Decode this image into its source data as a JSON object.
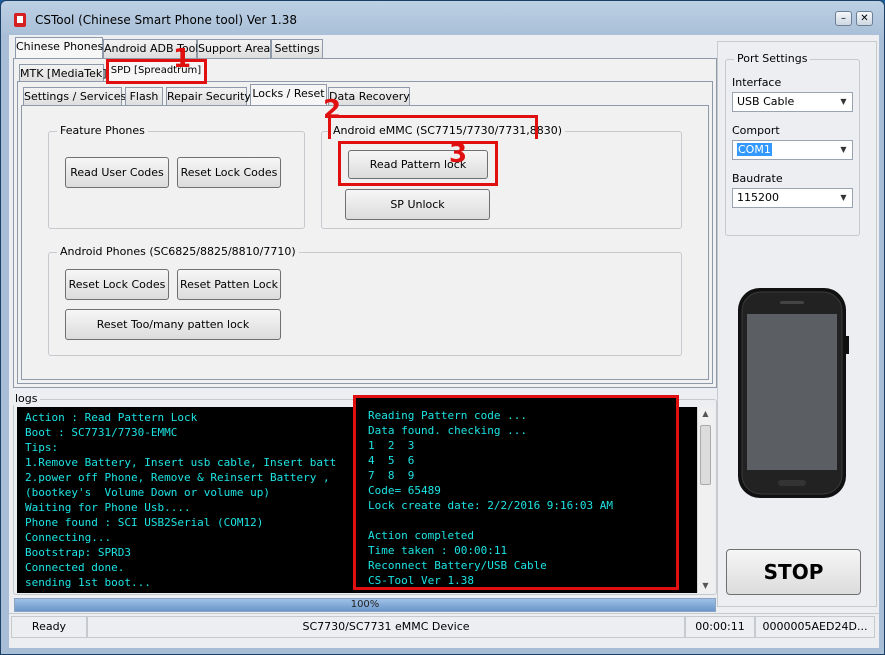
{
  "window": {
    "title": "CSTool (Chinese Smart Phone tool)  Ver 1.38"
  },
  "main_tabs": [
    {
      "label": "Chinese Phones"
    },
    {
      "label": "Android ADB Tool"
    },
    {
      "label": "Support Area"
    },
    {
      "label": "Settings"
    }
  ],
  "chipset_tabs": [
    {
      "label": "MTK [MediaTek]"
    },
    {
      "label": "SPD [Spreadtrum]"
    }
  ],
  "function_tabs": [
    {
      "label": "Settings / Services"
    },
    {
      "label": "Flash"
    },
    {
      "label": "Repair Security"
    },
    {
      "label": "Locks / Reset"
    },
    {
      "label": "Data Recovery"
    }
  ],
  "feature_phones": {
    "title": "Feature Phones",
    "read_user_codes": "Read User Codes",
    "reset_lock_codes": "Reset Lock Codes"
  },
  "android_emmc": {
    "title": "Android eMMC (SC7715/7730/7731,8830)",
    "read_pattern_lock": "Read Pattern lock",
    "sp_unlock": "SP Unlock"
  },
  "android_phones": {
    "title": "Android Phones (SC6825/8825/8810/7710)",
    "reset_lock_codes": "Reset Lock Codes",
    "reset_patten_lock": "Reset Patten Lock",
    "reset_too_many": "Reset Too/many patten lock"
  },
  "annotations": {
    "step1": "1",
    "step2": "2",
    "step3": "3"
  },
  "logs": {
    "label": "logs",
    "lines": [
      "Action : Read Pattern Lock",
      "Boot : SC7731/7730-EMMC",
      "Tips:",
      "1.Remove Battery, Insert usb cable, Insert batt",
      "2.power off Phone, Remove & Reinsert Battery ,",
      "(bootkey's  Volume Down or volume up)",
      "Waiting for Phone Usb....",
      "Phone found : SCI USB2Serial (COM12)",
      "Connecting...",
      "Bootstrap: SPRD3",
      "Connected done.",
      "sending 1st boot...",
      "..."
    ]
  },
  "result_console": {
    "lines": [
      "Reading Pattern code ...",
      "Data found. checking ...",
      "1  2  3",
      "4  5  6",
      "7  8  9",
      "Code= 65489",
      "Lock create date: 2/2/2016 9:16:03 AM",
      "",
      "Action completed",
      "Time taken : 00:00:11",
      "Reconnect Battery/USB Cable",
      "CS-Tool Ver 1.38"
    ]
  },
  "port_settings": {
    "title": "Port Settings",
    "interface_label": "Interface",
    "interface_value": "USB Cable",
    "comport_label": "Comport",
    "comport_value": "COM1",
    "baudrate_label": "Baudrate",
    "baudrate_value": "115200"
  },
  "stop_button": "STOP",
  "progress": {
    "value": 1.0,
    "text": "100%"
  },
  "status": {
    "state": "Ready",
    "device": "SC7730/SC7731 eMMC Device",
    "time": "00:00:11",
    "id": "0000005AED24D..."
  },
  "colors": {
    "console_bg": "#000000",
    "console_text": "#1de3e3",
    "highlight_red": "#e01010"
  }
}
